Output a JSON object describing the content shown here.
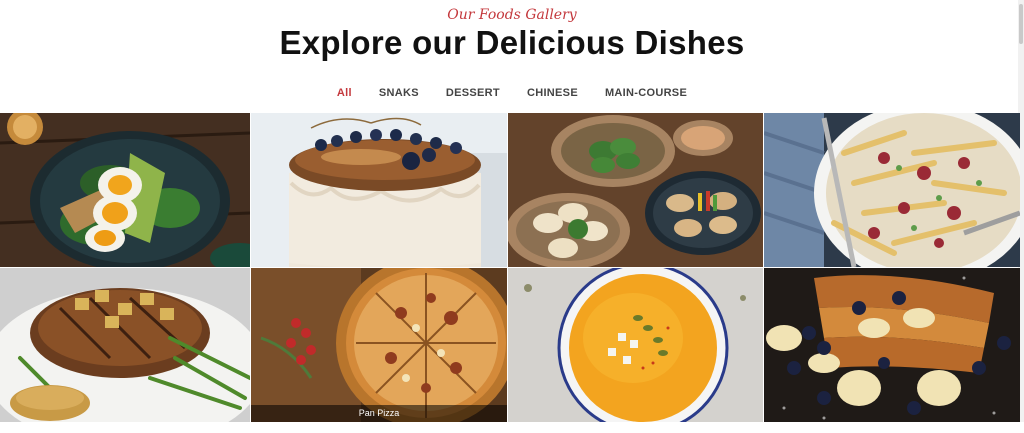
{
  "header": {
    "subtitle": "Our Foods Gallery",
    "title": "Explore our Delicious Dishes"
  },
  "filters": [
    {
      "label": "All",
      "active": true
    },
    {
      "label": "SNAKS",
      "active": false
    },
    {
      "label": "DESSERT",
      "active": false
    },
    {
      "label": "CHINESE",
      "active": false
    },
    {
      "label": "MAIN-COURSE",
      "active": false
    }
  ],
  "gallery": {
    "items": [
      {
        "dish": "egg-avocado-salad"
      },
      {
        "dish": "blueberry-cream-cake"
      },
      {
        "dish": "dumplings"
      },
      {
        "dish": "fries-with-toppings"
      },
      {
        "dish": "grilled-pork-chop"
      },
      {
        "dish": "pan-pizza",
        "caption": "Pan Pizza"
      },
      {
        "dish": "pumpkin-soup"
      },
      {
        "dish": "french-toast-with-banana"
      }
    ]
  },
  "colors": {
    "accent": "#c4393d",
    "title": "#111111",
    "filter_text": "#444444"
  }
}
